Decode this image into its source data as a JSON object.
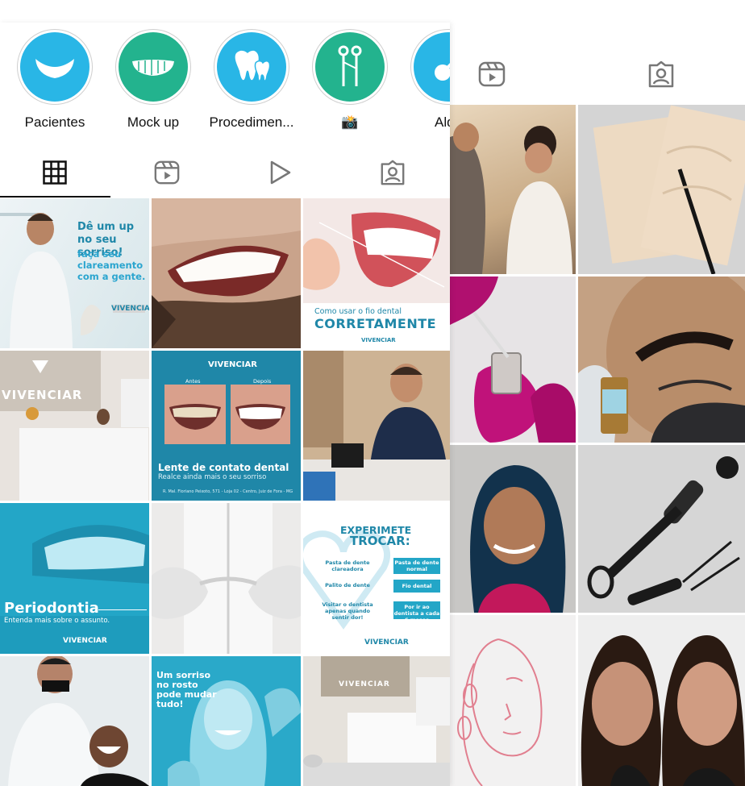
{
  "highlights": [
    {
      "label": "Pacientes",
      "icon": "smile-icon",
      "color": "#29b6e6"
    },
    {
      "label": "Mock up",
      "icon": "teeth-icon",
      "color": "#23b38e"
    },
    {
      "label": "Procedimen...",
      "icon": "tooth-icon",
      "color": "#29b6e6"
    },
    {
      "label": "📸",
      "icon": "dental-tools-icon",
      "color": "#23b38e"
    },
    {
      "label": "Alqu",
      "icon": "guitar-icon",
      "color": "#29b6e6"
    }
  ],
  "posts": {
    "p1": {
      "title": "Dê um up no seu sorriso!",
      "sub": "faça seu clareamento com a gente.",
      "brand": "VIVENCIAR"
    },
    "p3": {
      "line1": "Como usar o fio dental",
      "line2": "CORRETAMENTE"
    },
    "p4": {
      "sign": "VIVENCIAR"
    },
    "p5": {
      "brand": "VIVENCIAR",
      "before": "Antes",
      "after": "Depois",
      "title": "Lente de contato dental",
      "sub": "Realce ainda mais o seu sorriso",
      "address": "R. Mal. Floriano Peixoto, 571 - Loja 02 - Centro, Juiz de Fora - MG"
    },
    "p7": {
      "title": "Periodontia",
      "sub": "Entenda mais sobre o assunto.",
      "brand": "VIVENCIAR"
    },
    "p9": {
      "title1": "EXPERIMETE",
      "title2": "TROCAR:",
      "rows": [
        {
          "left": "Pasta de dente clareadora",
          "right": "Pasta de dente normal"
        },
        {
          "left": "Palito de dente",
          "right": "Fio dental"
        },
        {
          "left": "Visitar o dentista apenas quando sentir dor!",
          "right": "Por ir ao dentista a cada 6 meses"
        }
      ],
      "brand": "VIVENCIAR"
    },
    "p11": {
      "title": "Um sorriso no rosto pode mudar tudo!"
    },
    "p12": {
      "sign": "VIVENCIAR"
    }
  },
  "colors": {
    "accent": "#29b6e6",
    "teal": "#23b38e",
    "clinic_blue": "#1f87a8"
  }
}
